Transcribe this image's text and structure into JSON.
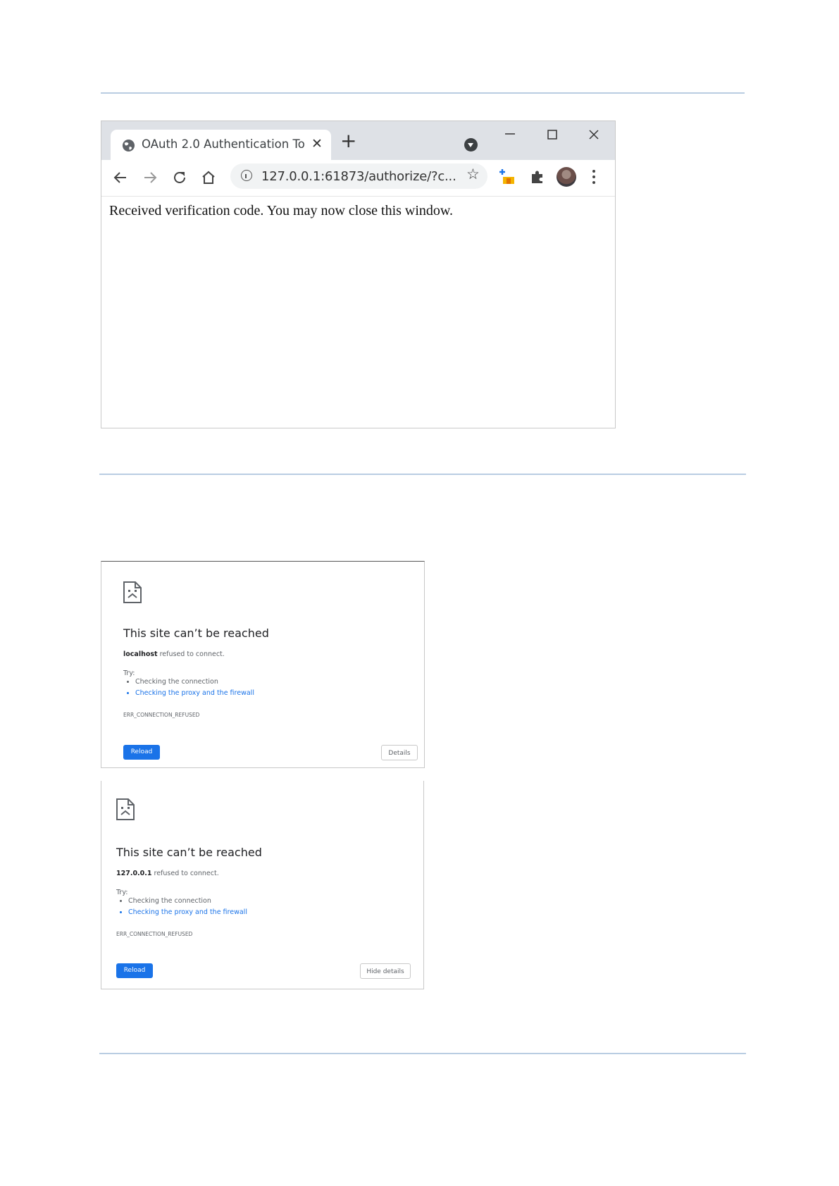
{
  "browser": {
    "tab": {
      "title": "OAuth 2.0 Authentication Token"
    },
    "omnibox": {
      "url": "127.0.0.1:61873/authorize/?c..."
    },
    "page_text": "Received verification code. You may now close this window."
  },
  "error_pages": [
    {
      "title": "This site can’t be reached",
      "host": "localhost",
      "message": " refused to connect.",
      "try_label": "Try:",
      "suggestions": [
        "Checking the connection",
        "Checking the proxy and the firewall"
      ],
      "error_code": "ERR_CONNECTION_REFUSED",
      "reload_label": "Reload",
      "details_label": "Details"
    },
    {
      "title": "This site can’t be reached",
      "host": "127.0.0.1",
      "message": " refused to connect.",
      "try_label": "Try:",
      "suggestions": [
        "Checking the connection",
        "Checking the proxy and the firewall"
      ],
      "error_code": "ERR_CONNECTION_REFUSED",
      "reload_label": "Reload",
      "details_label": "Hide details"
    }
  ],
  "colors": {
    "accent": "#1a73e8",
    "rule": "#b9cde2",
    "tabstrip": "#dee1e6"
  },
  "icons": [
    "globe-icon",
    "close-icon",
    "plus-icon",
    "tab-search-icon",
    "minimize-icon",
    "maximize-icon",
    "back-arrow-icon",
    "forward-arrow-icon",
    "reload-icon",
    "home-icon",
    "info-icon",
    "star-icon",
    "extension-upload-icon",
    "puzzle-icon",
    "avatar",
    "kebab-menu-icon",
    "sad-page-icon"
  ]
}
